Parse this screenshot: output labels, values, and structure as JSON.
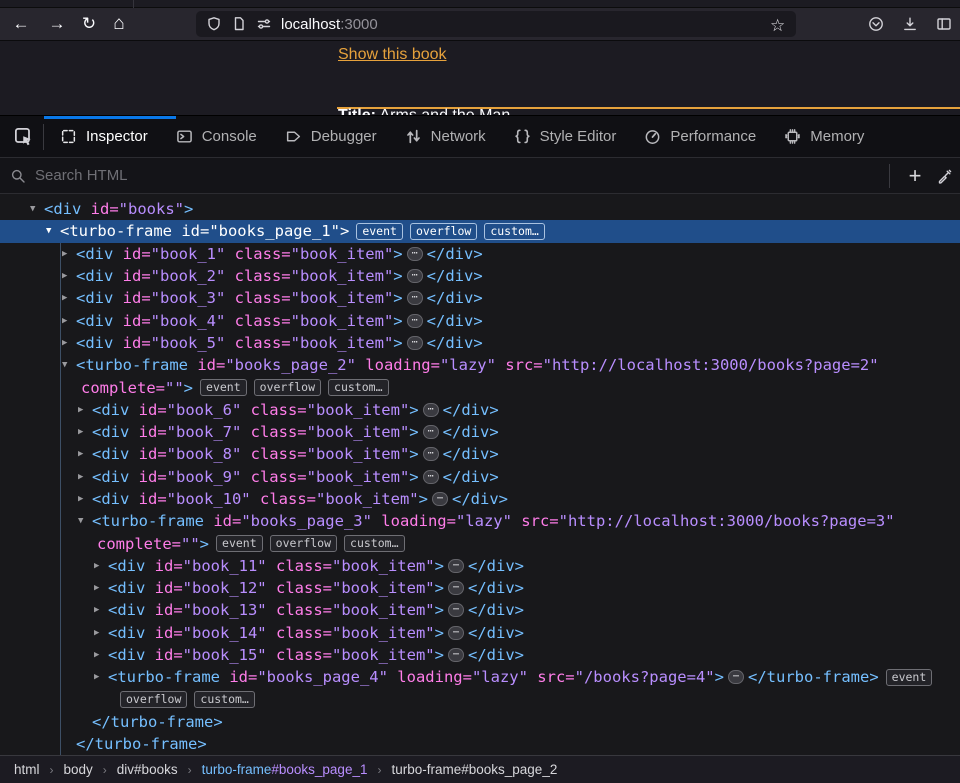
{
  "colors": {
    "accent": "#e6a23c",
    "tab_active_blue": "#0a78e8",
    "selection_blue": "#204e8a",
    "tag": "#75bfff",
    "attr": "#ff7de9",
    "val": "#b98eff",
    "plain": "#d7d7db"
  },
  "browser": {
    "url_host": "localhost",
    "url_port": ":3000"
  },
  "page": {
    "link_text": "Show this book",
    "title_label": "Title:",
    "title_value": " Arms and the Man"
  },
  "devtools": {
    "search_placeholder": "Search HTML",
    "tabs": [
      {
        "label": "Inspector",
        "icon": "inspector-icon",
        "active": true
      },
      {
        "label": "Console",
        "icon": "console-icon",
        "active": false
      },
      {
        "label": "Debugger",
        "icon": "debugger-icon",
        "active": false
      },
      {
        "label": "Network",
        "icon": "network-icon",
        "active": false
      },
      {
        "label": "Style Editor",
        "icon": "style-editor-icon",
        "active": false
      },
      {
        "label": "Performance",
        "icon": "performance-icon",
        "active": false
      },
      {
        "label": "Memory",
        "icon": "memory-icon",
        "active": false
      }
    ],
    "markup_rows": [
      {
        "level": 0,
        "exp": "open",
        "tokens": [
          [
            "tag",
            "<div"
          ],
          [
            "attr",
            " id="
          ],
          [
            "val",
            "\"books\""
          ],
          [
            "tag",
            ">"
          ]
        ]
      },
      {
        "level": 1,
        "exp": "open",
        "sel": true,
        "tokens": [
          [
            "tag",
            "<turbo-frame"
          ],
          [
            "attr",
            " id="
          ],
          [
            "val",
            "\"books_page_1\""
          ],
          [
            "tag",
            ">"
          ],
          [
            "badge",
            "event"
          ],
          [
            "badge",
            "overflow"
          ],
          [
            "badge",
            "custom…"
          ]
        ]
      },
      {
        "level": 2,
        "exp": "closed",
        "tokens": [
          [
            "tag",
            "<div"
          ],
          [
            "attr",
            " id="
          ],
          [
            "val",
            "\"book_1\""
          ],
          [
            "attr",
            " class="
          ],
          [
            "val",
            "\"book_item\""
          ],
          [
            "tag",
            ">"
          ],
          [
            "dots",
            ""
          ],
          [
            "tag",
            "</div>"
          ]
        ]
      },
      {
        "level": 2,
        "exp": "closed",
        "tokens": [
          [
            "tag",
            "<div"
          ],
          [
            "attr",
            " id="
          ],
          [
            "val",
            "\"book_2\""
          ],
          [
            "attr",
            " class="
          ],
          [
            "val",
            "\"book_item\""
          ],
          [
            "tag",
            ">"
          ],
          [
            "dots",
            ""
          ],
          [
            "tag",
            "</div>"
          ]
        ]
      },
      {
        "level": 2,
        "exp": "closed",
        "tokens": [
          [
            "tag",
            "<div"
          ],
          [
            "attr",
            " id="
          ],
          [
            "val",
            "\"book_3\""
          ],
          [
            "attr",
            " class="
          ],
          [
            "val",
            "\"book_item\""
          ],
          [
            "tag",
            ">"
          ],
          [
            "dots",
            ""
          ],
          [
            "tag",
            "</div>"
          ]
        ]
      },
      {
        "level": 2,
        "exp": "closed",
        "tokens": [
          [
            "tag",
            "<div"
          ],
          [
            "attr",
            " id="
          ],
          [
            "val",
            "\"book_4\""
          ],
          [
            "attr",
            " class="
          ],
          [
            "val",
            "\"book_item\""
          ],
          [
            "tag",
            ">"
          ],
          [
            "dots",
            ""
          ],
          [
            "tag",
            "</div>"
          ]
        ]
      },
      {
        "level": 2,
        "exp": "closed",
        "tokens": [
          [
            "tag",
            "<div"
          ],
          [
            "attr",
            " id="
          ],
          [
            "val",
            "\"book_5\""
          ],
          [
            "attr",
            " class="
          ],
          [
            "val",
            "\"book_item\""
          ],
          [
            "tag",
            ">"
          ],
          [
            "dots",
            ""
          ],
          [
            "tag",
            "</div>"
          ]
        ]
      },
      {
        "level": 2,
        "exp": "open",
        "tokens": [
          [
            "tag",
            "<turbo-frame"
          ],
          [
            "attr",
            " id="
          ],
          [
            "val",
            "\"books_page_2\""
          ],
          [
            "attr",
            " loading="
          ],
          [
            "val",
            "\"lazy\""
          ],
          [
            "attr",
            " src="
          ],
          [
            "val",
            "\"http://localhost:3000/books?page=2\""
          ]
        ]
      },
      {
        "level": 2,
        "cont": true,
        "tokens": [
          [
            "attr",
            "complete="
          ],
          [
            "val",
            "\"\""
          ],
          [
            "tag",
            ">"
          ],
          [
            "badge",
            "event"
          ],
          [
            "badge",
            "overflow"
          ],
          [
            "badge",
            "custom…"
          ]
        ]
      },
      {
        "level": 3,
        "exp": "closed",
        "tokens": [
          [
            "tag",
            "<div"
          ],
          [
            "attr",
            " id="
          ],
          [
            "val",
            "\"book_6\""
          ],
          [
            "attr",
            " class="
          ],
          [
            "val",
            "\"book_item\""
          ],
          [
            "tag",
            ">"
          ],
          [
            "dots",
            ""
          ],
          [
            "tag",
            "</div>"
          ]
        ]
      },
      {
        "level": 3,
        "exp": "closed",
        "tokens": [
          [
            "tag",
            "<div"
          ],
          [
            "attr",
            " id="
          ],
          [
            "val",
            "\"book_7\""
          ],
          [
            "attr",
            " class="
          ],
          [
            "val",
            "\"book_item\""
          ],
          [
            "tag",
            ">"
          ],
          [
            "dots",
            ""
          ],
          [
            "tag",
            "</div>"
          ]
        ]
      },
      {
        "level": 3,
        "exp": "closed",
        "tokens": [
          [
            "tag",
            "<div"
          ],
          [
            "attr",
            " id="
          ],
          [
            "val",
            "\"book_8\""
          ],
          [
            "attr",
            " class="
          ],
          [
            "val",
            "\"book_item\""
          ],
          [
            "tag",
            ">"
          ],
          [
            "dots",
            ""
          ],
          [
            "tag",
            "</div>"
          ]
        ]
      },
      {
        "level": 3,
        "exp": "closed",
        "tokens": [
          [
            "tag",
            "<div"
          ],
          [
            "attr",
            " id="
          ],
          [
            "val",
            "\"book_9\""
          ],
          [
            "attr",
            " class="
          ],
          [
            "val",
            "\"book_item\""
          ],
          [
            "tag",
            ">"
          ],
          [
            "dots",
            ""
          ],
          [
            "tag",
            "</div>"
          ]
        ]
      },
      {
        "level": 3,
        "exp": "closed",
        "tokens": [
          [
            "tag",
            "<div"
          ],
          [
            "attr",
            " id="
          ],
          [
            "val",
            "\"book_10\""
          ],
          [
            "attr",
            " class="
          ],
          [
            "val",
            "\"book_item\""
          ],
          [
            "tag",
            ">"
          ],
          [
            "dots",
            ""
          ],
          [
            "tag",
            "</div>"
          ]
        ]
      },
      {
        "level": 3,
        "exp": "open",
        "tokens": [
          [
            "tag",
            "<turbo-frame"
          ],
          [
            "attr",
            " id="
          ],
          [
            "val",
            "\"books_page_3\""
          ],
          [
            "attr",
            " loading="
          ],
          [
            "val",
            "\"lazy\""
          ],
          [
            "attr",
            " src="
          ],
          [
            "val",
            "\"http://localhost:3000/books?page=3\""
          ]
        ]
      },
      {
        "level": 3,
        "cont": true,
        "tokens": [
          [
            "attr",
            "complete="
          ],
          [
            "val",
            "\"\""
          ],
          [
            "tag",
            ">"
          ],
          [
            "badge",
            "event"
          ],
          [
            "badge",
            "overflow"
          ],
          [
            "badge",
            "custom…"
          ]
        ]
      },
      {
        "level": 4,
        "exp": "closed",
        "tokens": [
          [
            "tag",
            "<div"
          ],
          [
            "attr",
            " id="
          ],
          [
            "val",
            "\"book_11\""
          ],
          [
            "attr",
            " class="
          ],
          [
            "val",
            "\"book_item\""
          ],
          [
            "tag",
            ">"
          ],
          [
            "dots",
            ""
          ],
          [
            "tag",
            "</div>"
          ]
        ]
      },
      {
        "level": 4,
        "exp": "closed",
        "tokens": [
          [
            "tag",
            "<div"
          ],
          [
            "attr",
            " id="
          ],
          [
            "val",
            "\"book_12\""
          ],
          [
            "attr",
            " class="
          ],
          [
            "val",
            "\"book_item\""
          ],
          [
            "tag",
            ">"
          ],
          [
            "dots",
            ""
          ],
          [
            "tag",
            "</div>"
          ]
        ]
      },
      {
        "level": 4,
        "exp": "closed",
        "tokens": [
          [
            "tag",
            "<div"
          ],
          [
            "attr",
            " id="
          ],
          [
            "val",
            "\"book_13\""
          ],
          [
            "attr",
            " class="
          ],
          [
            "val",
            "\"book_item\""
          ],
          [
            "tag",
            ">"
          ],
          [
            "dots",
            ""
          ],
          [
            "tag",
            "</div>"
          ]
        ]
      },
      {
        "level": 4,
        "exp": "closed",
        "tokens": [
          [
            "tag",
            "<div"
          ],
          [
            "attr",
            " id="
          ],
          [
            "val",
            "\"book_14\""
          ],
          [
            "attr",
            " class="
          ],
          [
            "val",
            "\"book_item\""
          ],
          [
            "tag",
            ">"
          ],
          [
            "dots",
            ""
          ],
          [
            "tag",
            "</div>"
          ]
        ]
      },
      {
        "level": 4,
        "exp": "closed",
        "tokens": [
          [
            "tag",
            "<div"
          ],
          [
            "attr",
            " id="
          ],
          [
            "val",
            "\"book_15\""
          ],
          [
            "attr",
            " class="
          ],
          [
            "val",
            "\"book_item\""
          ],
          [
            "tag",
            ">"
          ],
          [
            "dots",
            ""
          ],
          [
            "tag",
            "</div>"
          ]
        ]
      },
      {
        "level": 4,
        "exp": "closed",
        "tokens": [
          [
            "tag",
            "<turbo-frame"
          ],
          [
            "attr",
            " id="
          ],
          [
            "val",
            "\"books_page_4\""
          ],
          [
            "attr",
            " loading="
          ],
          [
            "val",
            "\"lazy\""
          ],
          [
            "attr",
            " src="
          ],
          [
            "val",
            "\"/books?page=4\""
          ],
          [
            "tag",
            ">"
          ],
          [
            "dots",
            ""
          ],
          [
            "tag",
            "</turbo-frame>"
          ],
          [
            "badge",
            "event"
          ]
        ]
      },
      {
        "level": 4,
        "cont": true,
        "tokens": [
          [
            "badge",
            "overflow"
          ],
          [
            "badge",
            "custom…"
          ]
        ]
      },
      {
        "level": 3,
        "exp": "none",
        "tokens": [
          [
            "tag",
            "</turbo-frame>"
          ]
        ]
      },
      {
        "level": 2,
        "exp": "none",
        "tokens": [
          [
            "tag",
            "</turbo-frame>"
          ]
        ]
      }
    ],
    "breadcrumbs": [
      {
        "label": "html"
      },
      {
        "label": "body"
      },
      {
        "label": "div#books"
      },
      {
        "tag": "turbo-frame",
        "id": "#books_page_1",
        "selected": true
      },
      {
        "label": "turbo-frame#books_page_2"
      }
    ]
  }
}
